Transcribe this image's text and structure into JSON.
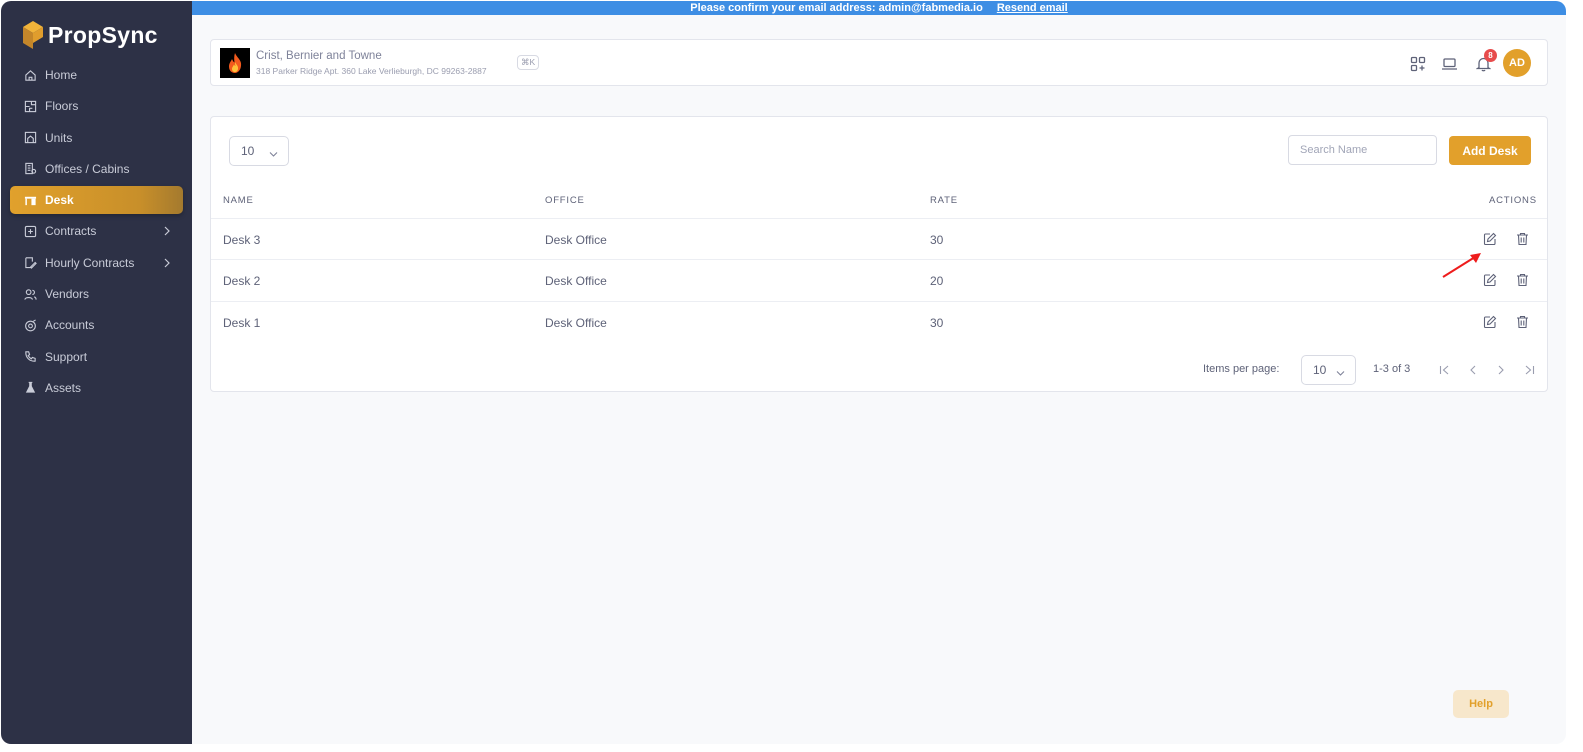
{
  "app": {
    "name": "PropSync",
    "brand_color": "#e2a02b",
    "sidebar_color": "#2d3146"
  },
  "banner": {
    "message": "Please confirm your email address: admin@fabmedia.io",
    "link": "Resend email",
    "color": "#3e8ee4"
  },
  "sidebar": {
    "items": [
      {
        "label": "Home",
        "icon": "home-icon"
      },
      {
        "label": "Floors",
        "icon": "floor-plan-icon"
      },
      {
        "label": "Units",
        "icon": "units-icon"
      },
      {
        "label": "Offices / Cabins",
        "icon": "office-building-icon"
      },
      {
        "label": "Desk",
        "icon": "desk-icon",
        "active": true
      },
      {
        "label": "Contracts",
        "icon": "contract-icon",
        "expandable": true
      },
      {
        "label": "Hourly Contracts",
        "icon": "hourly-contract-icon",
        "expandable": true
      },
      {
        "label": "Vendors",
        "icon": "users-icon"
      },
      {
        "label": "Accounts",
        "icon": "accounts-icon"
      },
      {
        "label": "Support",
        "icon": "phone-icon"
      },
      {
        "label": "Assets",
        "icon": "flask-icon"
      }
    ]
  },
  "header": {
    "company_name": "Crist, Bernier and Towne",
    "company_address": "318 Parker Ridge Apt. 360 Lake Verlieburgh, DC 99263-2887",
    "shortcut": "⌘K",
    "notification_count": "8",
    "avatar_initials": "AD"
  },
  "table": {
    "page_size": "10",
    "search_placeholder": "Search Name",
    "add_label": "Add Desk",
    "columns": {
      "name": "NAME",
      "office": "OFFICE",
      "rate": "RATE",
      "actions": "ACTIONS"
    },
    "rows": [
      {
        "name": "Desk 3",
        "office": "Desk Office",
        "rate": "30"
      },
      {
        "name": "Desk 2",
        "office": "Desk Office",
        "rate": "20"
      },
      {
        "name": "Desk 1",
        "office": "Desk Office",
        "rate": "30"
      }
    ],
    "pagination": {
      "items_label": "Items per page:",
      "items_per_page": "10",
      "range": "1-3 of 3"
    }
  },
  "help_label": "Help"
}
